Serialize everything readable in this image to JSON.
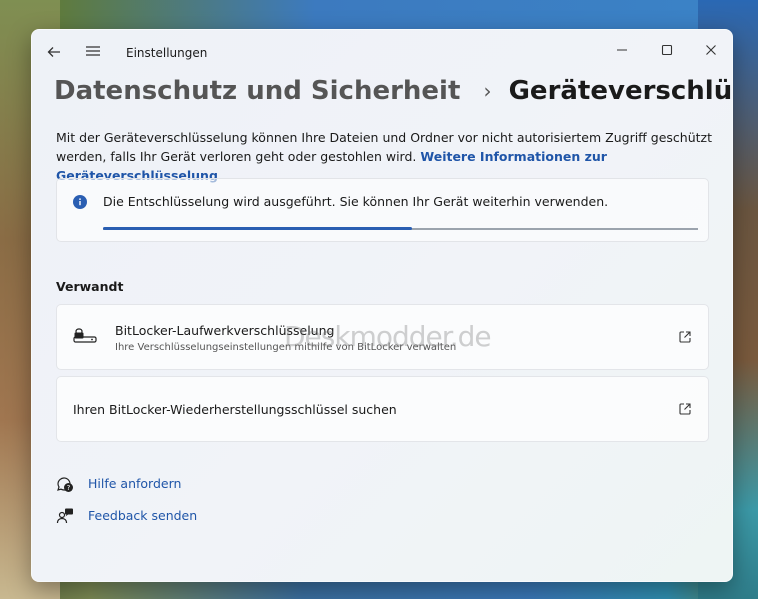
{
  "window": {
    "app_title": "Einstellungen"
  },
  "breadcrumb": {
    "parent": "Datenschutz und Sicherheit",
    "separator": "›",
    "current": "Geräteverschlüsselung"
  },
  "description": {
    "text": "Mit der Geräteverschlüsselung können Ihre Dateien und Ordner vor nicht autorisiertem Zugriff geschützt werden, falls Ihr Gerät verloren geht oder gestohlen wird.",
    "link": "Weitere Informationen zur Geräteverschlüsselung"
  },
  "status": {
    "message": "Die Entschlüsselung wird ausgeführt. Sie können Ihr Gerät weiterhin verwenden.",
    "progress_percent": 52,
    "accent_color": "#2a5eb2"
  },
  "related": {
    "section_label": "Verwandt",
    "items": [
      {
        "title": "BitLocker-Laufwerkverschlüsselung",
        "subtitle": "Ihre Verschlüsselungseinstellungen mithilfe von BitLocker verwalten",
        "icon": "drive-lock-icon"
      },
      {
        "title": "Ihren BitLocker-Wiederherstellungsschlüssel suchen"
      }
    ]
  },
  "footer_links": {
    "help": "Hilfe anfordern",
    "feedback": "Feedback senden"
  },
  "watermark": "Deskmodder.de"
}
